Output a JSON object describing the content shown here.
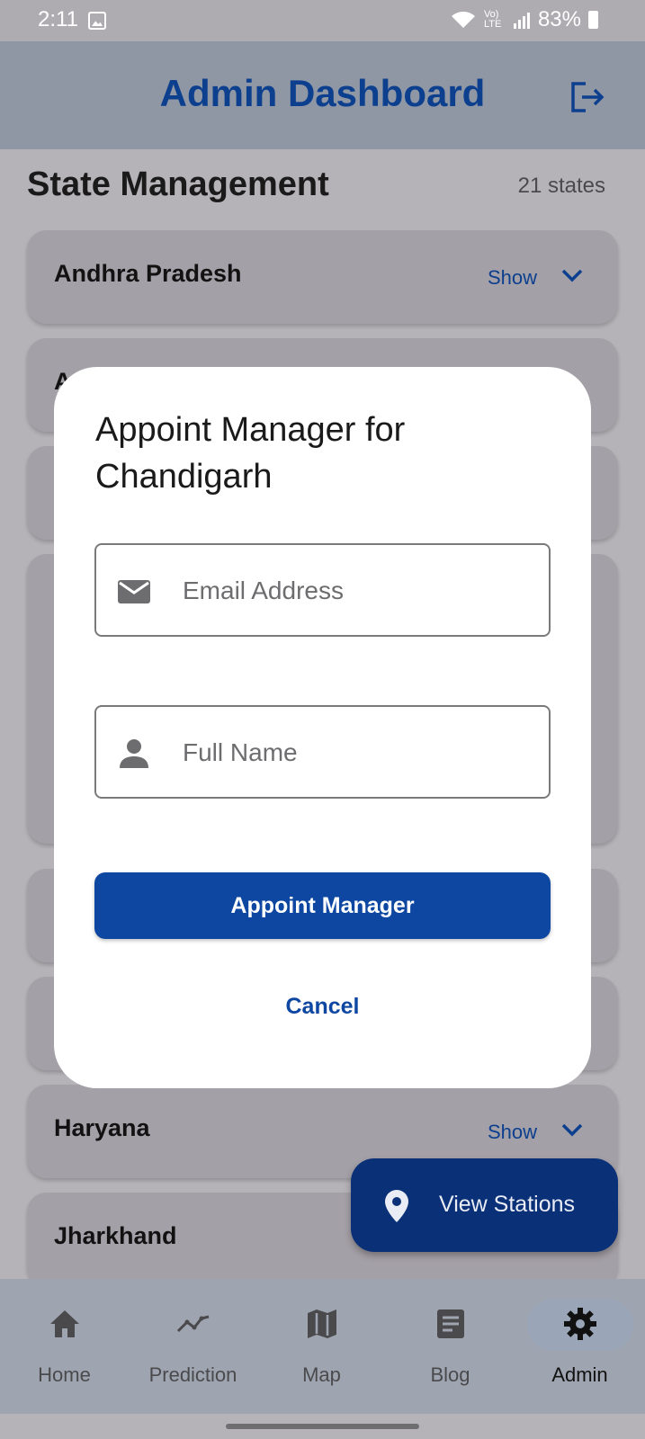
{
  "status_bar": {
    "time": "2:11",
    "battery": "83%",
    "network": "Vo) LTE"
  },
  "app_bar": {
    "title": "Admin Dashboard",
    "logout_icon": "logout-icon"
  },
  "section": {
    "title": "State Management",
    "count": "21 states"
  },
  "states": [
    {
      "name": "Andhra Pradesh",
      "toggle": "Show"
    },
    {
      "name": "A",
      "toggle": ""
    },
    {
      "name": "",
      "toggle": ""
    },
    {
      "name": "",
      "toggle": ""
    },
    {
      "name": "",
      "toggle": ""
    },
    {
      "name": "",
      "toggle": ""
    },
    {
      "name": "Haryana",
      "toggle": "Show"
    },
    {
      "name": "Jharkhand",
      "toggle": ""
    }
  ],
  "fab": {
    "label": "View Stations",
    "icon": "map-pin-icon"
  },
  "bottom_nav": [
    {
      "label": "Home",
      "icon": "home-icon"
    },
    {
      "label": "Prediction",
      "icon": "trend-icon"
    },
    {
      "label": "Map",
      "icon": "map-icon"
    },
    {
      "label": "Blog",
      "icon": "article-icon"
    },
    {
      "label": "Admin",
      "icon": "gear-icon",
      "active": true
    }
  ],
  "dialog": {
    "title": "Appoint Manager for Chandigarh",
    "email": {
      "placeholder": "Email Address",
      "value": "",
      "icon": "email-icon"
    },
    "name": {
      "placeholder": "Full Name",
      "value": "",
      "icon": "person-icon"
    },
    "primary_label": "Appoint Manager",
    "cancel_label": "Cancel"
  },
  "colors": {
    "primary": "#0d47a1",
    "fab": "#0a3078",
    "title": "#0c3f8e"
  }
}
